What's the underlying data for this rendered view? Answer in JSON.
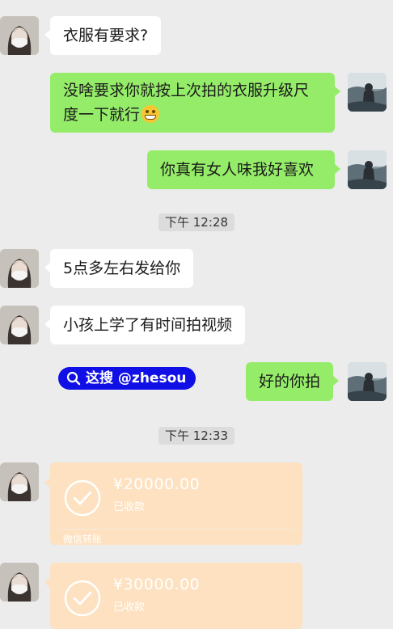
{
  "messages": {
    "m1": "衣服有要求?",
    "m2_line1": "没啥要求你就按上次拍的衣服升级尺",
    "m2_line2": "度一下就行",
    "m3": "你真有女人味我好喜欢",
    "t1": "下午 12:28",
    "m4": "5点多左右发给你",
    "m5": "小孩上学了有时间拍视频",
    "m6": "好的你拍",
    "t2": "下午 12:33"
  },
  "watermark": {
    "label": "这搜 @zhesou"
  },
  "transfers": [
    {
      "amount": "¥20000.00",
      "status": "已收款",
      "footer": "微信转账"
    },
    {
      "amount": "¥30000.00",
      "status": "已收款"
    }
  ],
  "colors": {
    "background": "#ececec",
    "green_bubble": "#95ec69",
    "white_bubble": "#ffffff",
    "transfer_card": "#fde1c0",
    "watermark": "#1010e6"
  }
}
